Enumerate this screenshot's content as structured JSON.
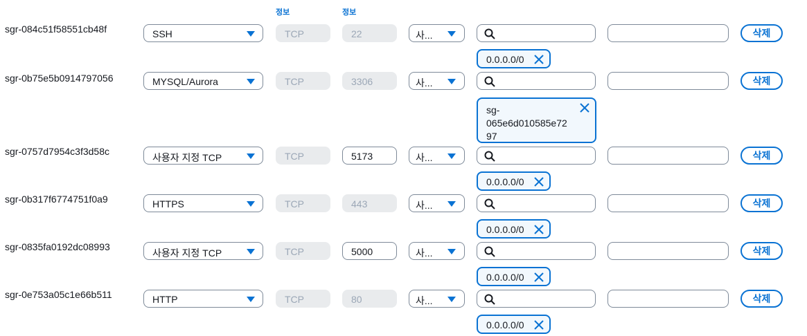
{
  "headers": {
    "protocol_info": "정보",
    "port_info": "정보"
  },
  "rows": [
    {
      "id": "sgr-084c51f58551cb48f",
      "type": "SSH",
      "protocol": "TCP",
      "port": "22",
      "source": "사...",
      "token": "0.0.0.0/0",
      "delete": "삭제"
    },
    {
      "id": "sgr-0b75e5b0914797056",
      "type": "MYSQL/Aurora",
      "protocol": "TCP",
      "port": "3306",
      "source": "사...",
      "token_lines": [
        "sg-",
        "065e6d010585e72",
        "97"
      ],
      "delete": "삭제"
    },
    {
      "id": "sgr-0757d7954c3f3d58c",
      "type": "사용자 지정 TCP",
      "protocol": "TCP",
      "port": "5173",
      "source": "사...",
      "token": "0.0.0.0/0",
      "delete": "삭제"
    },
    {
      "id": "sgr-0b317f6774751f0a9",
      "type": "HTTPS",
      "protocol": "TCP",
      "port": "443",
      "source": "사...",
      "token": "0.0.0.0/0",
      "delete": "삭제"
    },
    {
      "id": "sgr-0835fa0192dc08993",
      "type": "사용자 지정 TCP",
      "protocol": "TCP",
      "port": "5000",
      "source": "사...",
      "token": "0.0.0.0/0",
      "delete": "삭제"
    },
    {
      "id": "sgr-0e753a05c1e66b511",
      "type": "HTTP",
      "protocol": "TCP",
      "port": "80",
      "source": "사...",
      "token": "0.0.0.0/0",
      "delete": "삭제"
    }
  ],
  "colors": {
    "accent": "#0972d3",
    "disabled_bg": "#e9ebed",
    "border": "#7d8998"
  },
  "icons": {
    "search": "search-icon",
    "remove": "close-icon",
    "dropdown": "caret-down-icon"
  }
}
